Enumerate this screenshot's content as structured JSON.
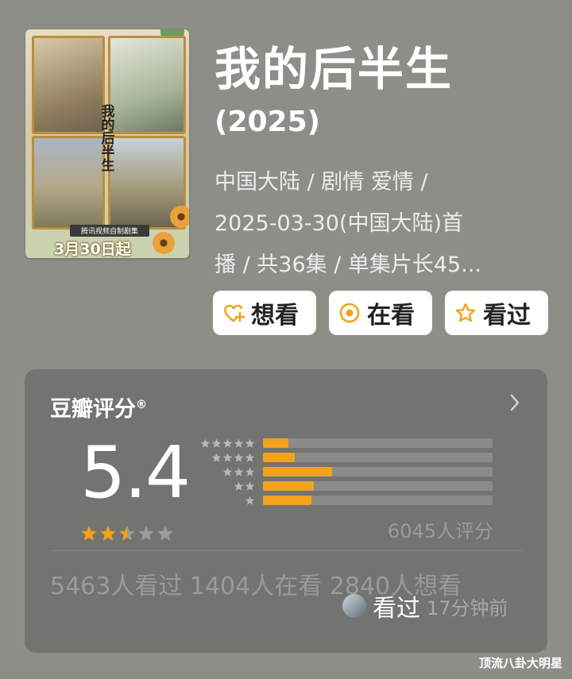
{
  "poster": {
    "title_chars": "我的后半生",
    "subtitle": "腾讯视频自制剧集",
    "date_text": "3月30日起"
  },
  "show": {
    "title": "我的后半生",
    "year": "(2025)",
    "meta_lines": [
      "中国大陆 / 剧情 爱情 /",
      "2025-03-30(中国大陆)首",
      "播 / 共36集 / 单集片长45..."
    ]
  },
  "actions": [
    {
      "label": "想看",
      "icon": "heart-plus-icon"
    },
    {
      "label": "在看",
      "icon": "target-circle-icon"
    },
    {
      "label": "看过",
      "icon": "star-outline-icon"
    }
  ],
  "rating": {
    "heading": "豆瓣评分",
    "registered": "®",
    "score": "5.4",
    "stars_value": 2.5,
    "stars_max": 5,
    "distribution": [
      {
        "stars": 5,
        "fraction": 0.11
      },
      {
        "stars": 4,
        "fraction": 0.14
      },
      {
        "stars": 3,
        "fraction": 0.3
      },
      {
        "stars": 2,
        "fraction": 0.22
      },
      {
        "stars": 1,
        "fraction": 0.21
      }
    ],
    "count_text": "6045人评分"
  },
  "stats": {
    "text": "5463人看过    1404人在看    2840人想看"
  },
  "popup": {
    "action": "看过",
    "time_ago": "17分钟前"
  },
  "watermark": "顶流八卦大明星",
  "colors": {
    "accent": "#f2a21c",
    "background": "#8e8e89",
    "card": "#737370"
  }
}
